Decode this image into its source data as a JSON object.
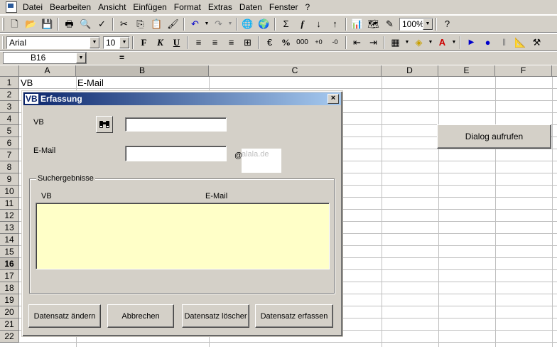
{
  "menubar": {
    "items": [
      "Datei",
      "Bearbeiten",
      "Ansicht",
      "Einfügen",
      "Format",
      "Extras",
      "Daten",
      "Fenster",
      "?"
    ]
  },
  "toolbar": {
    "zoom": "100%",
    "font_name": "Arial",
    "font_size": "10",
    "bold": "F",
    "italic": "K",
    "underline": "U",
    "sum": "Σ",
    "fx": "f",
    "percent": "%",
    "thousands": "000",
    "font_color": "A"
  },
  "formula_bar": {
    "name_box": "B16",
    "equals": "=",
    "content": ""
  },
  "sheet": {
    "columns": [
      "A",
      "B",
      "C",
      "D",
      "E",
      "F"
    ],
    "selected_column": "B",
    "rows": [
      "1",
      "2",
      "3",
      "4",
      "5",
      "6",
      "7",
      "8",
      "9",
      "10",
      "11",
      "12",
      "13",
      "14",
      "15",
      "16",
      "17",
      "18",
      "19",
      "20",
      "21",
      "22"
    ],
    "selected_row": "16",
    "cells": {
      "A1": "VB",
      "B1": "E-Mail"
    },
    "button_label": "Dialog aufrufen"
  },
  "dialog": {
    "title_highlight": "VB",
    "title_rest": " Erfassung",
    "close_label": "×",
    "vb_label": "VB",
    "vb_value": "",
    "email_label": "E-Mail",
    "email_value": "",
    "at_sign": "@",
    "domain": "alala.de",
    "group_title": "Suchergebnisse",
    "results_header_vb": "VB",
    "results_header_email": "E-Mail",
    "buttons": [
      "Datensatz ändern",
      "Abbrechen",
      "Datensatz löscher",
      "Datensatz erfassen"
    ]
  },
  "colors": {
    "face": "#d4d0c8",
    "titlebar_start": "#0a246a",
    "titlebar_end": "#a6caf0",
    "results_bg": "#ffffc8"
  }
}
